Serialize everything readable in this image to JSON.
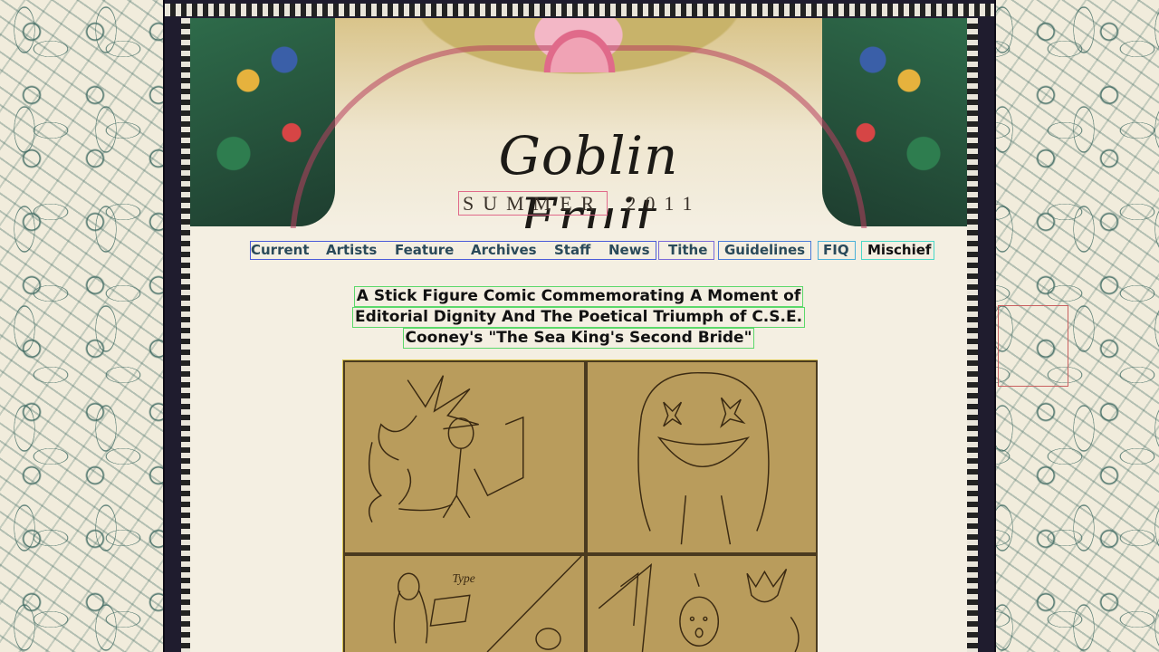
{
  "header": {
    "logo": "Goblin Fruit",
    "season": "SUMMER",
    "year": "2011"
  },
  "nav": {
    "items": [
      {
        "label": "Current"
      },
      {
        "label": "Artists"
      },
      {
        "label": "Feature"
      },
      {
        "label": "Archives"
      },
      {
        "label": "Staff"
      },
      {
        "label": "News"
      },
      {
        "label": "Tithe"
      },
      {
        "label": "Guidelines"
      },
      {
        "label": "FIQ"
      },
      {
        "label": "Mischief"
      }
    ]
  },
  "article": {
    "title_line1": "A Stick Figure Comic Commemorating A Moment of",
    "title_line2": "Editorial Dignity And The Poetical Triumph of C.S.E.",
    "title_line3": "Cooney's \"The Sea King's Second Bride\""
  },
  "comic": {
    "panel3_text": "Type"
  },
  "colors": {
    "frame": "#1f1c2e",
    "page": "#f4efe2",
    "comic_bg": "#b79a59",
    "nav_text": "#2a4a5a"
  }
}
